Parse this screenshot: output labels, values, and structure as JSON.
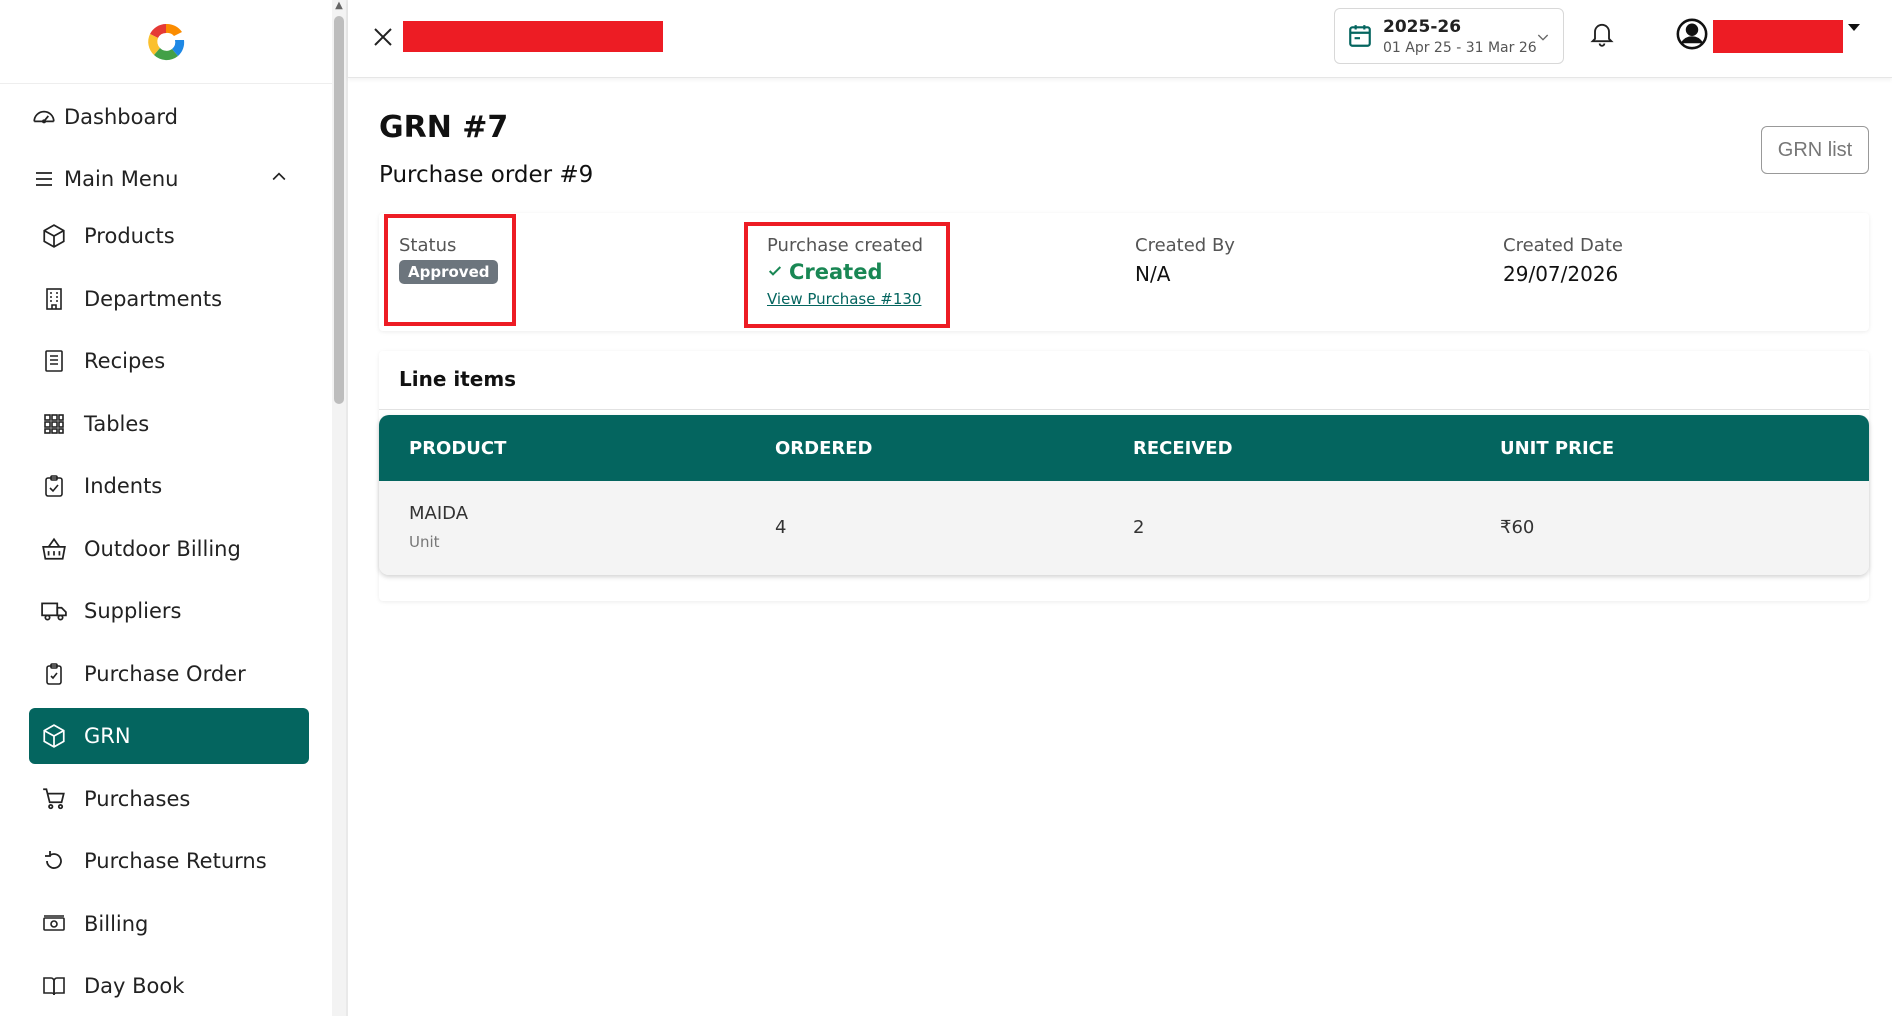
{
  "sidebar": {
    "items": [
      {
        "label": "Dashboard",
        "icon": "gauge-icon"
      },
      {
        "label": "Main Menu",
        "icon": "menu-icon"
      },
      {
        "label": "Products",
        "icon": "box-icon"
      },
      {
        "label": "Departments",
        "icon": "building-icon"
      },
      {
        "label": "Recipes",
        "icon": "receipt-icon"
      },
      {
        "label": "Tables",
        "icon": "grid-icon"
      },
      {
        "label": "Indents",
        "icon": "clipboard-icon"
      },
      {
        "label": "Outdoor Billing",
        "icon": "basket-icon"
      },
      {
        "label": "Suppliers",
        "icon": "truck-icon"
      },
      {
        "label": "Purchase Order",
        "icon": "clipboard-check-icon"
      },
      {
        "label": "GRN",
        "icon": "box-icon",
        "active": true
      },
      {
        "label": "Purchases",
        "icon": "cart-icon"
      },
      {
        "label": "Purchase Returns",
        "icon": "refresh-icon"
      },
      {
        "label": "Billing",
        "icon": "cash-icon"
      },
      {
        "label": "Day Book",
        "icon": "book-icon"
      }
    ]
  },
  "header": {
    "fy_year": "2025-26",
    "fy_range": "01 Apr 25 - 31 Mar 26"
  },
  "page": {
    "title": "GRN #7",
    "subtitle": "Purchase order #9",
    "grn_list_label": "GRN list"
  },
  "info": {
    "status_label": "Status",
    "status_value": "Approved",
    "purchase_label": "Purchase created",
    "purchase_value": "Created",
    "purchase_link": "View Purchase #130",
    "created_by_label": "Created By",
    "created_by_value": "N/A",
    "created_date_label": "Created Date",
    "created_date_value": "29/07/2026"
  },
  "line_items": {
    "title": "Line items",
    "headers": [
      "PRODUCT",
      "ORDERED",
      "RECEIVED",
      "UNIT PRICE"
    ],
    "rows": [
      {
        "product": "MAIDA",
        "unit": "Unit",
        "ordered": "4",
        "received": "2",
        "unit_price": "₹60"
      }
    ]
  },
  "colors": {
    "primary": "#04655f",
    "success": "#198754",
    "badge": "#6c757d",
    "highlight": "#ed1c24"
  }
}
